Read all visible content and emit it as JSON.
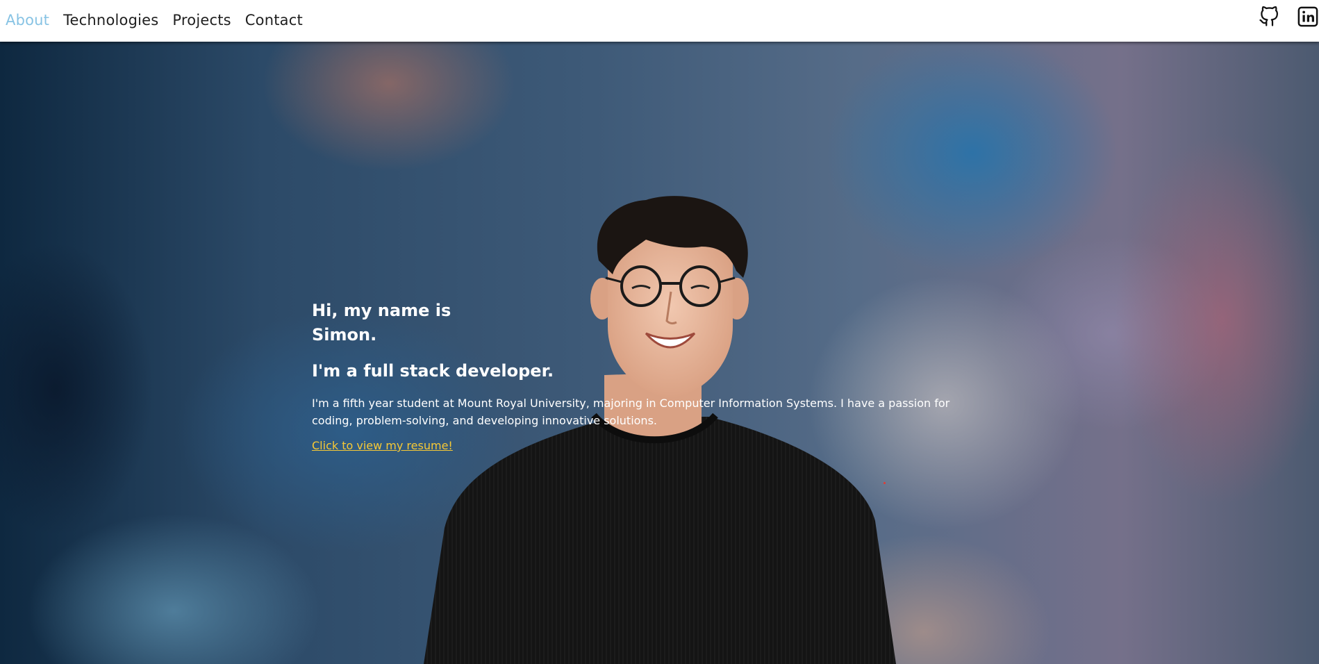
{
  "nav": {
    "links": [
      {
        "label": "About",
        "active": true
      },
      {
        "label": "Technologies",
        "active": false
      },
      {
        "label": "Projects",
        "active": false
      },
      {
        "label": "Contact",
        "active": false
      }
    ],
    "icons": [
      "github-icon",
      "linkedin-icon"
    ],
    "active_color": "#87c3e4"
  },
  "hero": {
    "greeting": "Hi, my name is Simon.",
    "role": "I'm a full stack developer.",
    "bio": "I'm a fifth year student at Mount Royal University, majoring in Computer Information Systems. I have a passion for coding, problem-solving, and developing innovative solutions.",
    "resume_link": "Click to view my resume!",
    "link_color": "#f7c935"
  }
}
